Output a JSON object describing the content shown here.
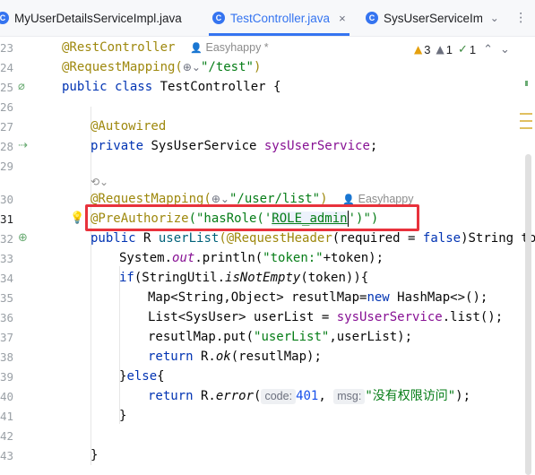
{
  "tabs": [
    {
      "label": "MyUserDetailsServiceImpl.java",
      "active": false
    },
    {
      "label": "TestController.java",
      "active": true,
      "close": "×"
    },
    {
      "label": "SysUserServiceIm",
      "active": false
    }
  ],
  "inspections": {
    "warnings": "3",
    "weak": "1",
    "ok": "1"
  },
  "line_numbers": [
    "23",
    "24",
    "25",
    "26",
    "27",
    "28",
    "29",
    "",
    "30",
    "31",
    "32",
    "33",
    "34",
    "35",
    "36",
    "37",
    "38",
    "39",
    "40",
    "41",
    "42",
    "43"
  ],
  "code": {
    "l23_ann": "@RestController",
    "l23_author": "Easyhappy *",
    "l24_ann": "@RequestMapping(",
    "l24_str": "\"/test\"",
    "l24_close": ")",
    "l25_kw": "public class",
    "l25_rest": " TestController {",
    "l27_ann": "@Autowired",
    "l28_kw": "private",
    "l28_type": " SysUserService ",
    "l28_field": "sysUserService",
    "l28_end": ";",
    "l30_ann": "@RequestMapping(",
    "l30_str": "\"/user/list\"",
    "l30_close": ")",
    "l30_author": "Easyhappy",
    "l31_ann": "@PreAuthorize",
    "l31_open": "(\"hasRole('",
    "l31_role": "ROLE_admin",
    "l31_close": "')\")",
    "l32_kw": "public",
    "l32_type": " R ",
    "l32_method": "userList",
    "l32_ann": "(@RequestHeader",
    "l32_mid": "(required = ",
    "l32_false": "false",
    "l32_end": ")String token",
    "l33_a": "System.",
    "l33_out": "out",
    "l33_b": ".println(",
    "l33_str": "\"token:\"",
    "l33_c": "+token);",
    "l34_kw": "if",
    "l34_a": "(StringUtil.",
    "l34_m": "isNotEmpty",
    "l34_b": "(token)){",
    "l35_a": "Map<String,Object> resutlMap=",
    "l35_kw": "new",
    "l35_b": " HashMap<>();",
    "l36_a": "List<SysUser> userList = ",
    "l36_field": "sysUserService",
    "l36_b": ".list();",
    "l37_a": "resutlMap.put(",
    "l37_str": "\"userList\"",
    "l37_b": ",userList);",
    "l38_kw": "return",
    "l38_a": " R.",
    "l38_m": "ok",
    "l38_b": "(resutlMap);",
    "l39_a": "}",
    "l39_kw": "else",
    "l39_b": "{",
    "l40_kw": "return",
    "l40_a": " R.",
    "l40_m": "error",
    "l40_p": "(",
    "l40_hint1": "code:",
    "l40_num": "401",
    "l40_comma": ", ",
    "l40_hint2": "msg:",
    "l40_str": "\"没有权限访问\"",
    "l40_end": ");",
    "l41": "}",
    "l43": "}"
  },
  "colors": {
    "accent": "#3574f0",
    "highlight_box": "#e8323c",
    "string": "#067d17",
    "keyword": "#0033b3",
    "annotation": "#9e880d"
  }
}
